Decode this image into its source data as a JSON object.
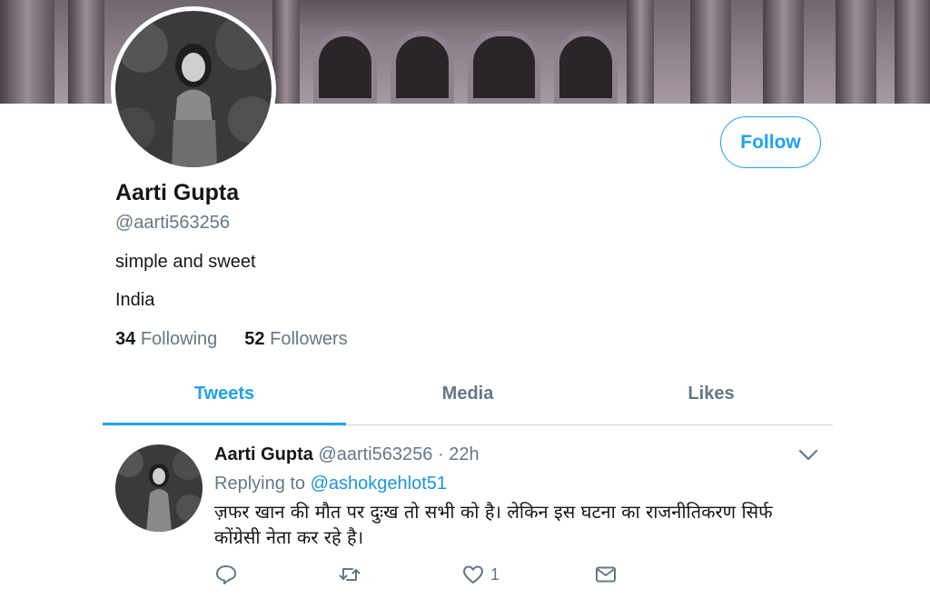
{
  "profile": {
    "name": "Aarti Gupta",
    "handle": "@aarti563256",
    "bio": "simple and sweet",
    "location": "India",
    "following_count": "34",
    "following_label": "Following",
    "followers_count": "52",
    "followers_label": "Followers"
  },
  "actions": {
    "follow_label": "Follow"
  },
  "tabs": [
    {
      "label": "Tweets",
      "active": true
    },
    {
      "label": "Media",
      "active": false
    },
    {
      "label": "Likes",
      "active": false
    }
  ],
  "tweet": {
    "name": "Aarti Gupta",
    "handle": "@aarti563256",
    "separator": "·",
    "time": "22h",
    "replying_prefix": "Replying to",
    "replying_to": "@ashokgehlot51",
    "text": "ज़फर खान की मौत पर दुःख तो सभी को है। लेकिन इस घटना का राजनीतिकरण सिर्फ कोंग्रेसी नेता कर रहे है।",
    "reply_count": "",
    "retweet_count": "",
    "like_count": "1"
  },
  "colors": {
    "accent": "#1da1f2",
    "secondary_text": "#657786",
    "primary_text": "#14171a"
  },
  "icons": {
    "reply": "reply-icon",
    "retweet": "retweet-icon",
    "like": "heart-icon",
    "dm": "envelope-icon",
    "more": "chevron-down-icon"
  }
}
